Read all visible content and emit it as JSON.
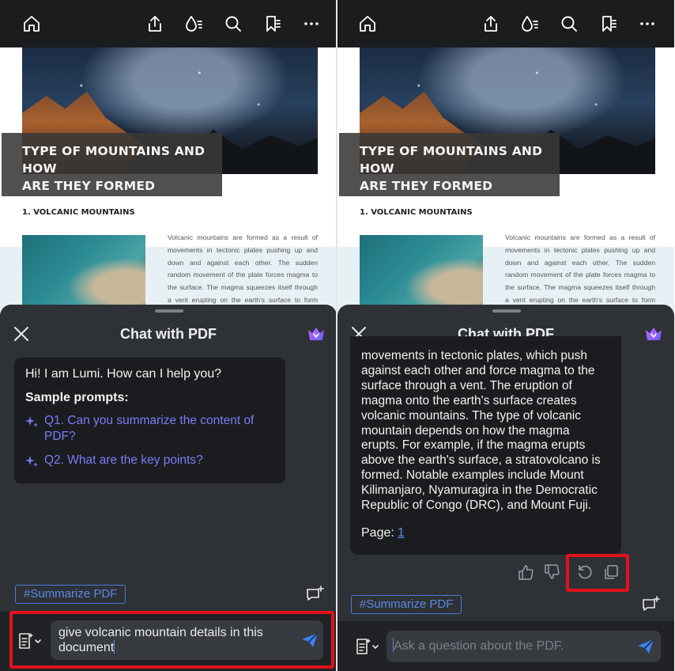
{
  "toolbar": {
    "icons": [
      "home-icon",
      "share-icon",
      "ink-icon",
      "search-icon",
      "bookmark-list-icon",
      "more-icon"
    ]
  },
  "document": {
    "title_line1": "TYPE OF MOUNTAINS AND HOW",
    "title_line2": "ARE THEY FORMED",
    "section_heading": "1. VOLCANIC MOUNTAINS",
    "body_text": "Volcanic mountains are formed as a result of movements in tectonic plates pushing up and down and against each other. The sudden random movement of the plate forces magma to the surface. The magma squeezes itself through a vent erupting on the earth's surface to form volcanic"
  },
  "chat": {
    "title": "Chat with PDF",
    "greeting": "Hi! I am Lumi. How can I help you?",
    "sample_heading": "Sample prompts:",
    "prompts": [
      "Q1. Can you summarize the content of PDF?",
      "Q2. What are the key points?"
    ],
    "summarize_chip": "#Summarize PDF",
    "input_value": "give volcanic mountain details in this document",
    "input_placeholder": "Ask a question about the PDF.",
    "answer_text": "movements in tectonic plates, which push against each other and force magma to the surface through a vent. The eruption of magma onto the earth's surface creates volcanic mountains. The type of volcanic mountain depends on how the magma erupts. For example, if the magma erupts above the earth's surface, a stratovolcano is formed. Notable examples include Mount Kilimanjaro, Nyamuragira in the Democratic Republic of Congo (DRC), and Mount Fuji.",
    "page_label": "Page:",
    "page_number": "1"
  },
  "colors": {
    "toolbar_bg": "#1b1c1e",
    "sheet_bg": "#2e3136",
    "bubble_bg": "#1b1c1f",
    "prompt_accent": "#7a7df5",
    "chip_accent": "#5b8ae6",
    "highlight_red": "#e0121c"
  }
}
